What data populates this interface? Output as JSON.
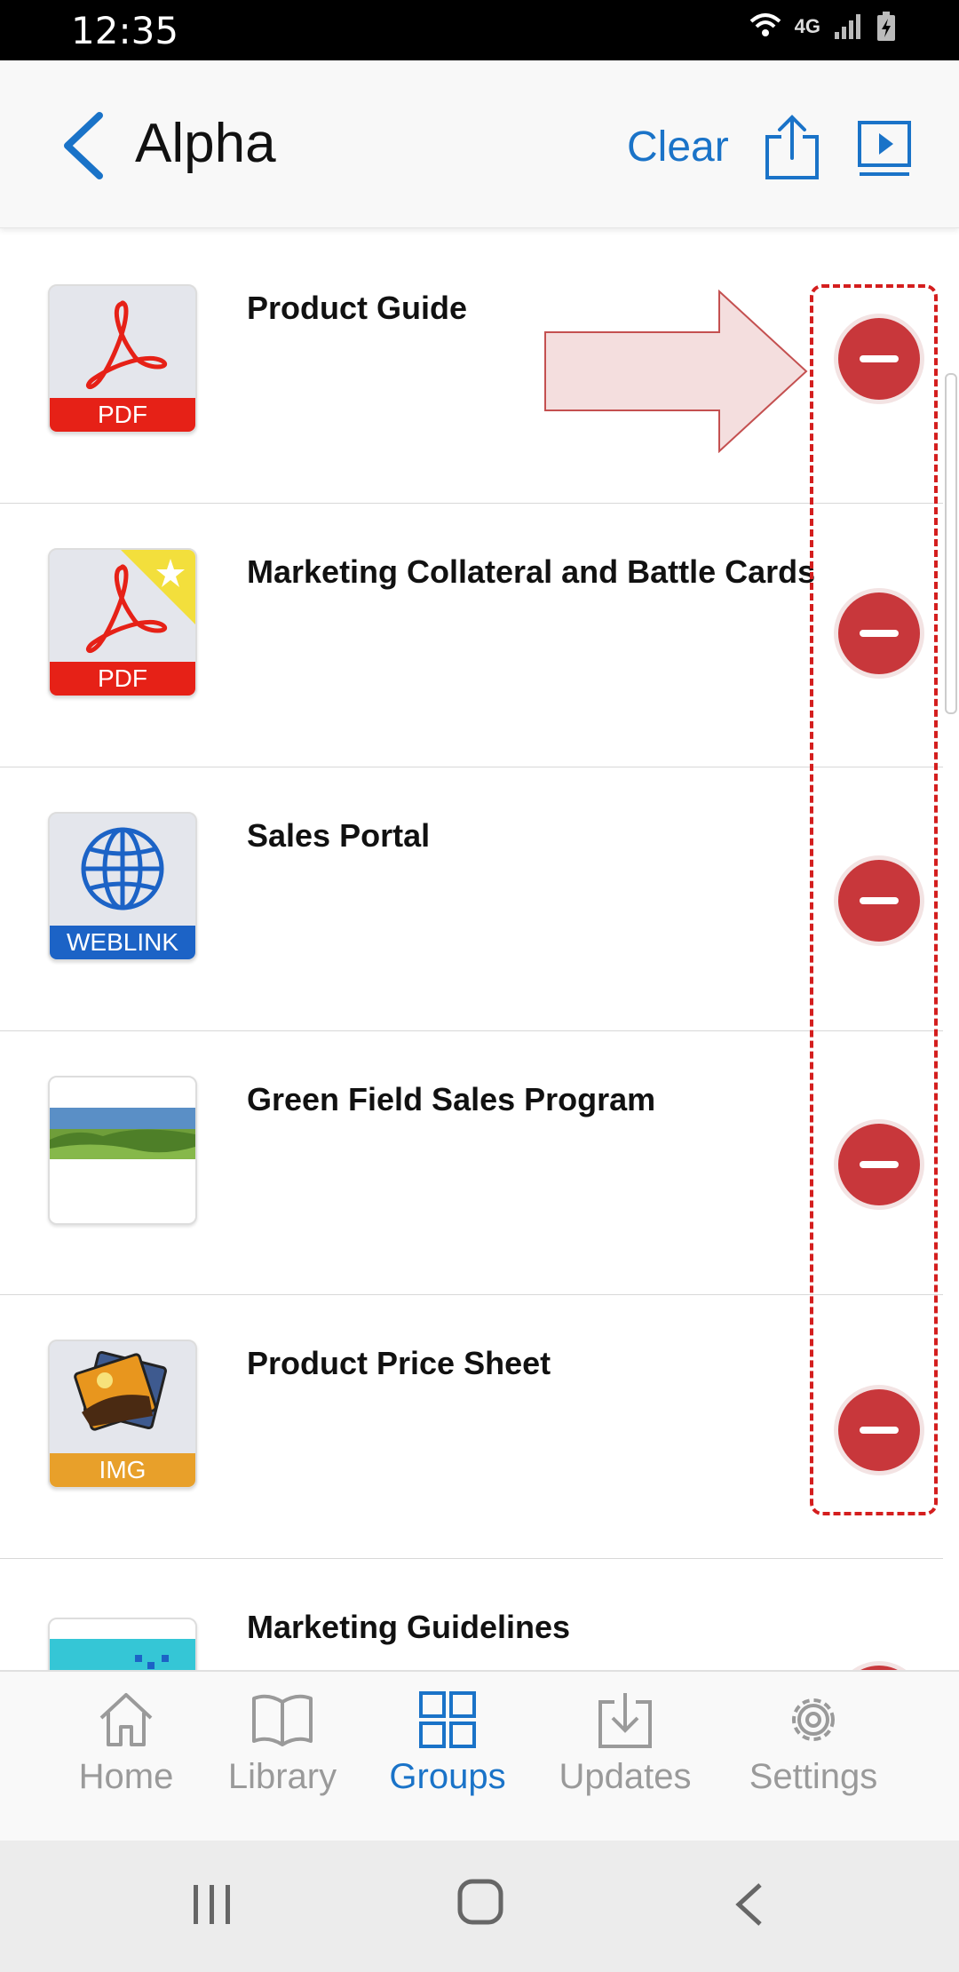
{
  "status": {
    "time": "12:35",
    "network": "4G"
  },
  "header": {
    "title": "Alpha",
    "clear_label": "Clear"
  },
  "items": [
    {
      "title": "Product Guide",
      "type_label": "PDF",
      "type_color": "#e62117",
      "starred": false
    },
    {
      "title": "Marketing Collateral and Battle Cards",
      "type_label": "PDF",
      "type_color": "#e62117",
      "starred": true
    },
    {
      "title": "Sales Portal",
      "type_label": "WEBLINK",
      "type_color": "#1c63c6",
      "starred": false
    },
    {
      "title": "Green Field Sales Program",
      "type_label": "",
      "type_color": "",
      "starred": false
    },
    {
      "title": "Product Price Sheet",
      "type_label": "IMG",
      "type_color": "#e8a02a",
      "starred": false
    },
    {
      "title": "Marketing Guidelines",
      "type_label": "",
      "type_color": "",
      "starred": false
    }
  ],
  "tabs": [
    {
      "label": "Home",
      "icon": "home-icon",
      "active": false
    },
    {
      "label": "Library",
      "icon": "book-icon",
      "active": false
    },
    {
      "label": "Groups",
      "icon": "grid-icon",
      "active": true
    },
    {
      "label": "Updates",
      "icon": "download-icon",
      "active": false
    },
    {
      "label": "Settings",
      "icon": "gear-icon",
      "active": false
    }
  ],
  "colors": {
    "accent": "#1a73c8",
    "remove": "#c8373b",
    "annotation": "#d41e1e"
  }
}
